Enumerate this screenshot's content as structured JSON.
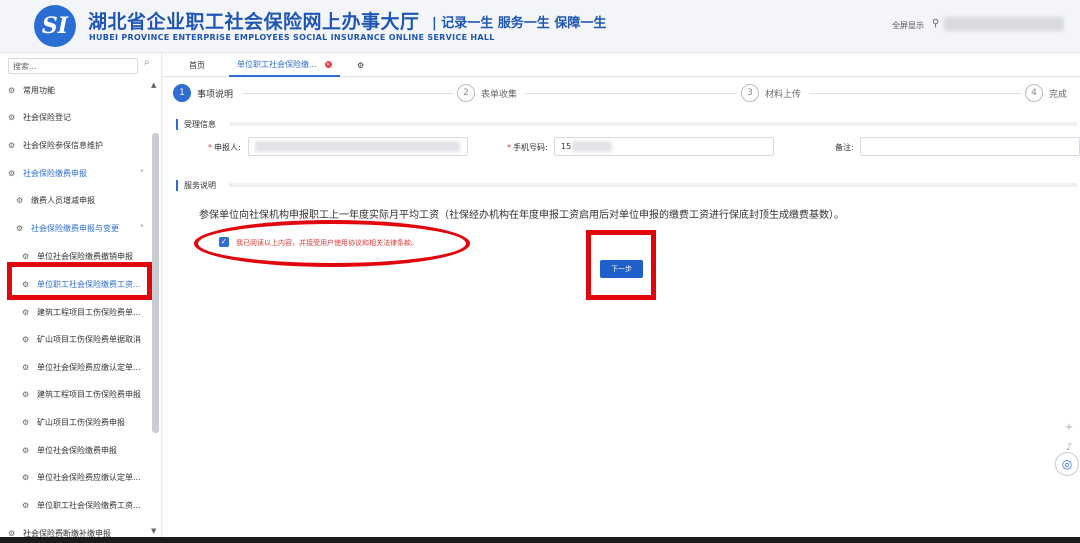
{
  "header": {
    "logo_text": "SI",
    "title": "湖北省企业职工社会保险网上办事大厅",
    "slogan": "| 记录一生 服务一生 保障一生",
    "subtitle": "HUBEI PROVINCE ENTERPRISE EMPLOYEES SOCIAL INSURANCE ONLINE SERVICE HALL",
    "fullscreen_label": "全屏显示",
    "user_icon": "person-icon"
  },
  "sidebar": {
    "search_placeholder": "搜索...",
    "items": [
      {
        "label": "常用功能",
        "icon": "gear-icon"
      },
      {
        "label": "社会保险登记",
        "icon": "gear-icon"
      },
      {
        "label": "社会保险参保信息维护",
        "icon": "gear-icon"
      },
      {
        "label": "社会保险缴费申报",
        "icon": "gear-icon",
        "chevron": "˄"
      },
      {
        "label": "缴费人员增减申报",
        "icon": "gear-icon"
      },
      {
        "label": "社会保险缴费申报与变更",
        "icon": "gear-icon",
        "chevron": "˄"
      },
      {
        "label": "单位社会保险缴费撤销申报",
        "icon": "gear-icon"
      },
      {
        "label": "单位职工社会保险缴费工资...",
        "icon": "gear-icon"
      },
      {
        "label": "建筑工程项目工伤保险费单...",
        "icon": "gear-icon"
      },
      {
        "label": "矿山项目工伤保险费单据取消",
        "icon": "gear-icon"
      },
      {
        "label": "单位社会保险费应缴认定单...",
        "icon": "gear-icon"
      },
      {
        "label": "建筑工程项目工伤保险费申报",
        "icon": "gear-icon"
      },
      {
        "label": "矿山项目工伤保险费申报",
        "icon": "gear-icon"
      },
      {
        "label": "单位社会保险缴费申报",
        "icon": "gear-icon"
      },
      {
        "label": "单位社会保险费应缴认定单...",
        "icon": "gear-icon"
      },
      {
        "label": "单位职工社会保险缴费工资...",
        "icon": "gear-icon"
      },
      {
        "label": "社会保险费断缴补缴申报",
        "icon": "gear-icon"
      }
    ]
  },
  "tabs": [
    {
      "label": "首页"
    },
    {
      "label": "单位职工社会保险缴..."
    }
  ],
  "steps": [
    {
      "num": "1",
      "label": "事项说明"
    },
    {
      "num": "2",
      "label": "表单收集"
    },
    {
      "num": "3",
      "label": "材料上传"
    },
    {
      "num": "4",
      "label": "完成"
    }
  ],
  "form": {
    "section_title": "受理信息",
    "applicant_label": "申报人:",
    "phone_label": "手机号码:",
    "phone_value": "15",
    "remark_label": "备注:"
  },
  "service": {
    "section_title": "服务说明",
    "notice": "参保单位向社保机构申报职工上一年度实际月平均工资（社保经办机构在年度申报工资启用后对单位申报的缴费工资进行保底封顶生成缴费基数）。",
    "agree_text": "我已阅读以上内容，并接受用户使用协议和相关法律条款。",
    "next_button": "下一步"
  },
  "colors": {
    "brand_blue": "#1f56b4",
    "accent_blue": "#2f6dd3",
    "highlight_red": "#e1060e"
  }
}
